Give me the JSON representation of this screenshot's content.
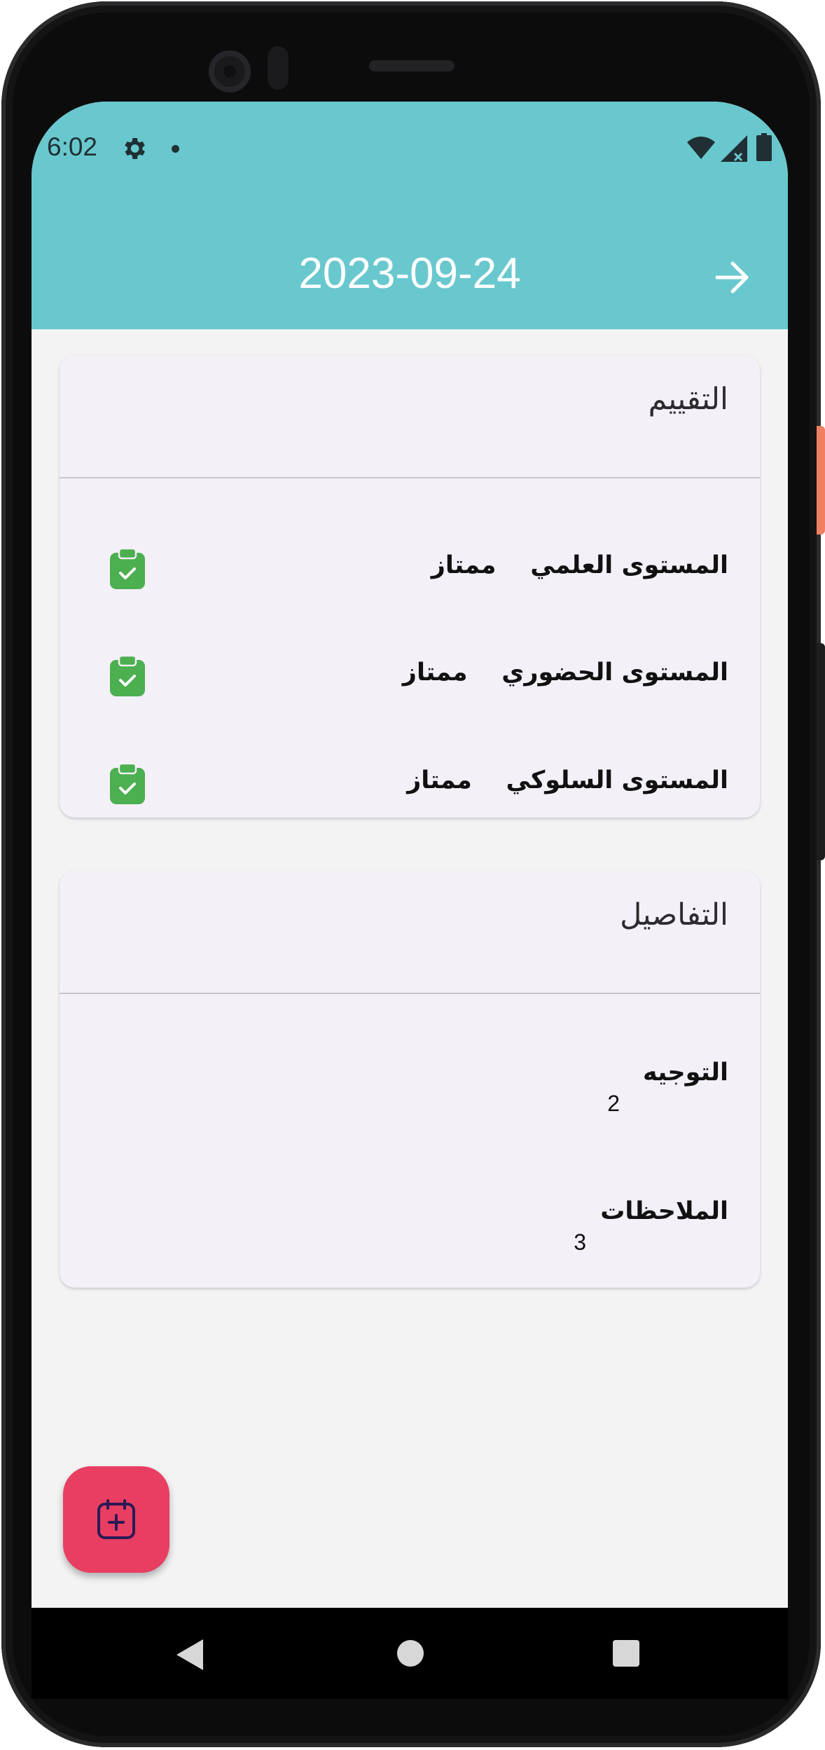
{
  "status_bar": {
    "time": "6:02",
    "icons": [
      "gear-icon",
      "notification-dot-icon",
      "wifi-icon",
      "signal-icon",
      "battery-icon"
    ]
  },
  "app_bar": {
    "title": "2023-09-24",
    "back_icon": "arrow-right-icon",
    "background_color": "#69c8ce"
  },
  "rating_card": {
    "header": "التقييم",
    "rows": [
      {
        "label": "المستوى العلمي",
        "value": "ممتاز",
        "icon": "clipboard-check-icon"
      },
      {
        "label": "المستوى الحضوري",
        "value": "ممتاز",
        "icon": "clipboard-check-icon"
      },
      {
        "label": "المستوى السلوكي",
        "value": "ممتاز",
        "icon": "clipboard-check-icon"
      }
    ]
  },
  "details_card": {
    "header": "التفاصيل",
    "items": [
      {
        "title": "التوجيه",
        "value": "2"
      },
      {
        "title": "الملاحظات",
        "value": "3"
      }
    ]
  },
  "fab": {
    "icon": "calendar-add-icon",
    "color": "#e83e62"
  },
  "nav_bar": {
    "icons": [
      "back-triangle-icon",
      "home-circle-icon",
      "recents-square-icon"
    ]
  },
  "colors": {
    "accent": "#69c8ce",
    "check_green": "#4caf50",
    "card_background": "#f4f0f7"
  }
}
